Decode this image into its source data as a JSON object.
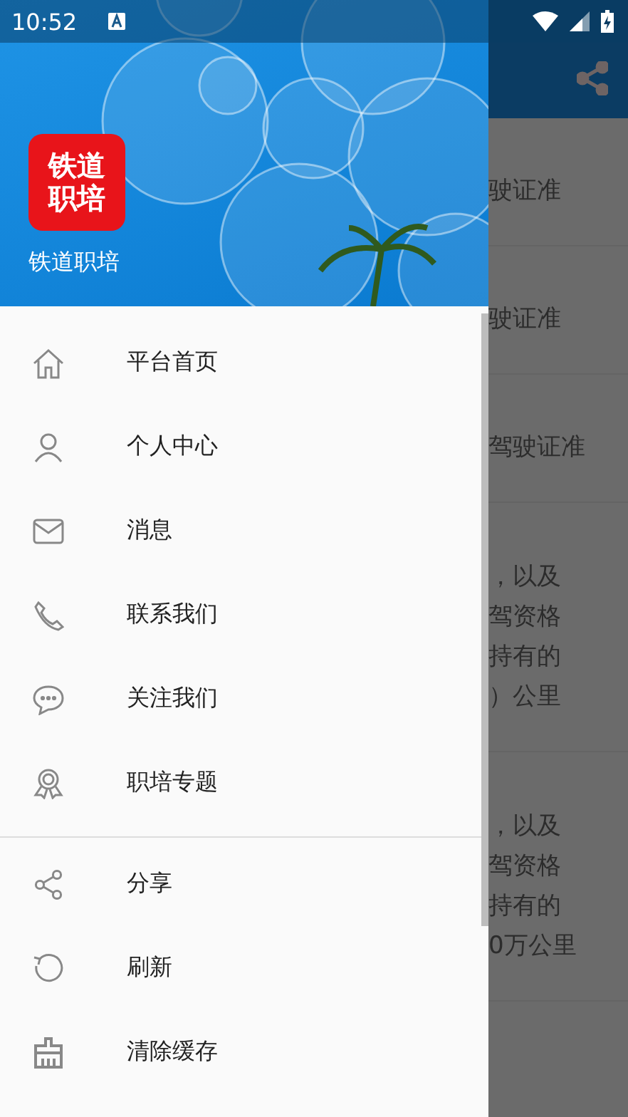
{
  "status_bar": {
    "time": "10:52"
  },
  "drawer": {
    "header": {
      "logo_lines": [
        "铁道",
        "职培"
      ],
      "app_name": "铁道职培"
    },
    "menu_groups": [
      [
        {
          "label": "平台首页"
        },
        {
          "label": "个人中心"
        },
        {
          "label": "消息"
        },
        {
          "label": "联系我们"
        },
        {
          "label": "关注我们"
        },
        {
          "label": "职培专题"
        }
      ],
      [
        {
          "label": "分享"
        },
        {
          "label": "刷新"
        },
        {
          "label": "清除缓存"
        }
      ]
    ]
  },
  "background_content": {
    "items": [
      {
        "lines": [
          "驶证准"
        ]
      },
      {
        "lines": [
          "驶证准"
        ]
      },
      {
        "lines": [
          "驾驶证准"
        ]
      },
      {
        "lines": [
          "，以及",
          "驾资格",
          "持有的",
          "）公里"
        ]
      },
      {
        "lines": [
          "，以及",
          "驾资格",
          "持有的",
          "0万公里"
        ]
      }
    ]
  }
}
